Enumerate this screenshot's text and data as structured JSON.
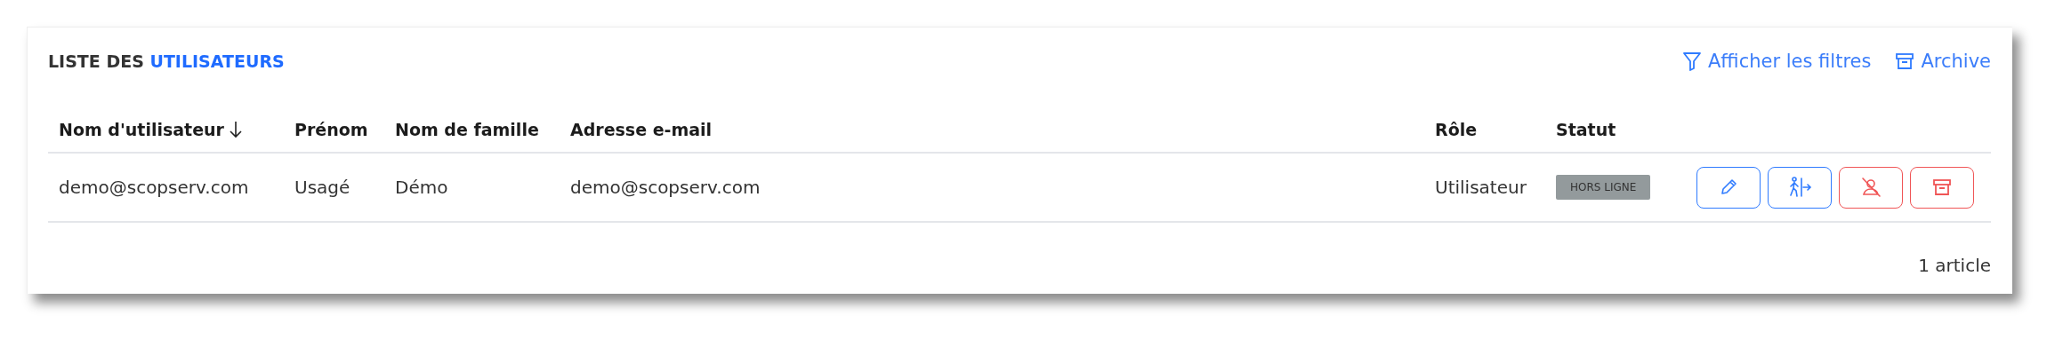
{
  "title": {
    "prefix": "LISTE DES",
    "highlight": "UTILISATEURS"
  },
  "header_links": [
    {
      "kind": "filter",
      "label": "Afficher les filtres"
    },
    {
      "kind": "archive",
      "label": "Archive"
    }
  ],
  "table": {
    "columns": [
      {
        "label": "Nom d'utilisateur",
        "sorted": true
      },
      {
        "label": "Prénom",
        "sorted": false
      },
      {
        "label": "Nom de famille",
        "sorted": false
      },
      {
        "label": "Adresse e-mail",
        "sorted": false
      },
      {
        "label": "Rôle",
        "sorted": false
      },
      {
        "label": "Statut",
        "sorted": false
      }
    ],
    "rows": [
      {
        "cells": [
          "demo@scopserv.com",
          "Usagé",
          "Démo",
          "demo@scopserv.com",
          "Utilisateur"
        ],
        "status": "HORS LIGNE",
        "actions": [
          {
            "kind": "edit",
            "color": "#2f7bff"
          },
          {
            "kind": "exit",
            "color": "#2f7bff"
          },
          {
            "kind": "disable",
            "color": "#f05556"
          },
          {
            "kind": "archive",
            "color": "#f05556"
          }
        ]
      }
    ]
  },
  "footer": {
    "count": "1 article"
  }
}
